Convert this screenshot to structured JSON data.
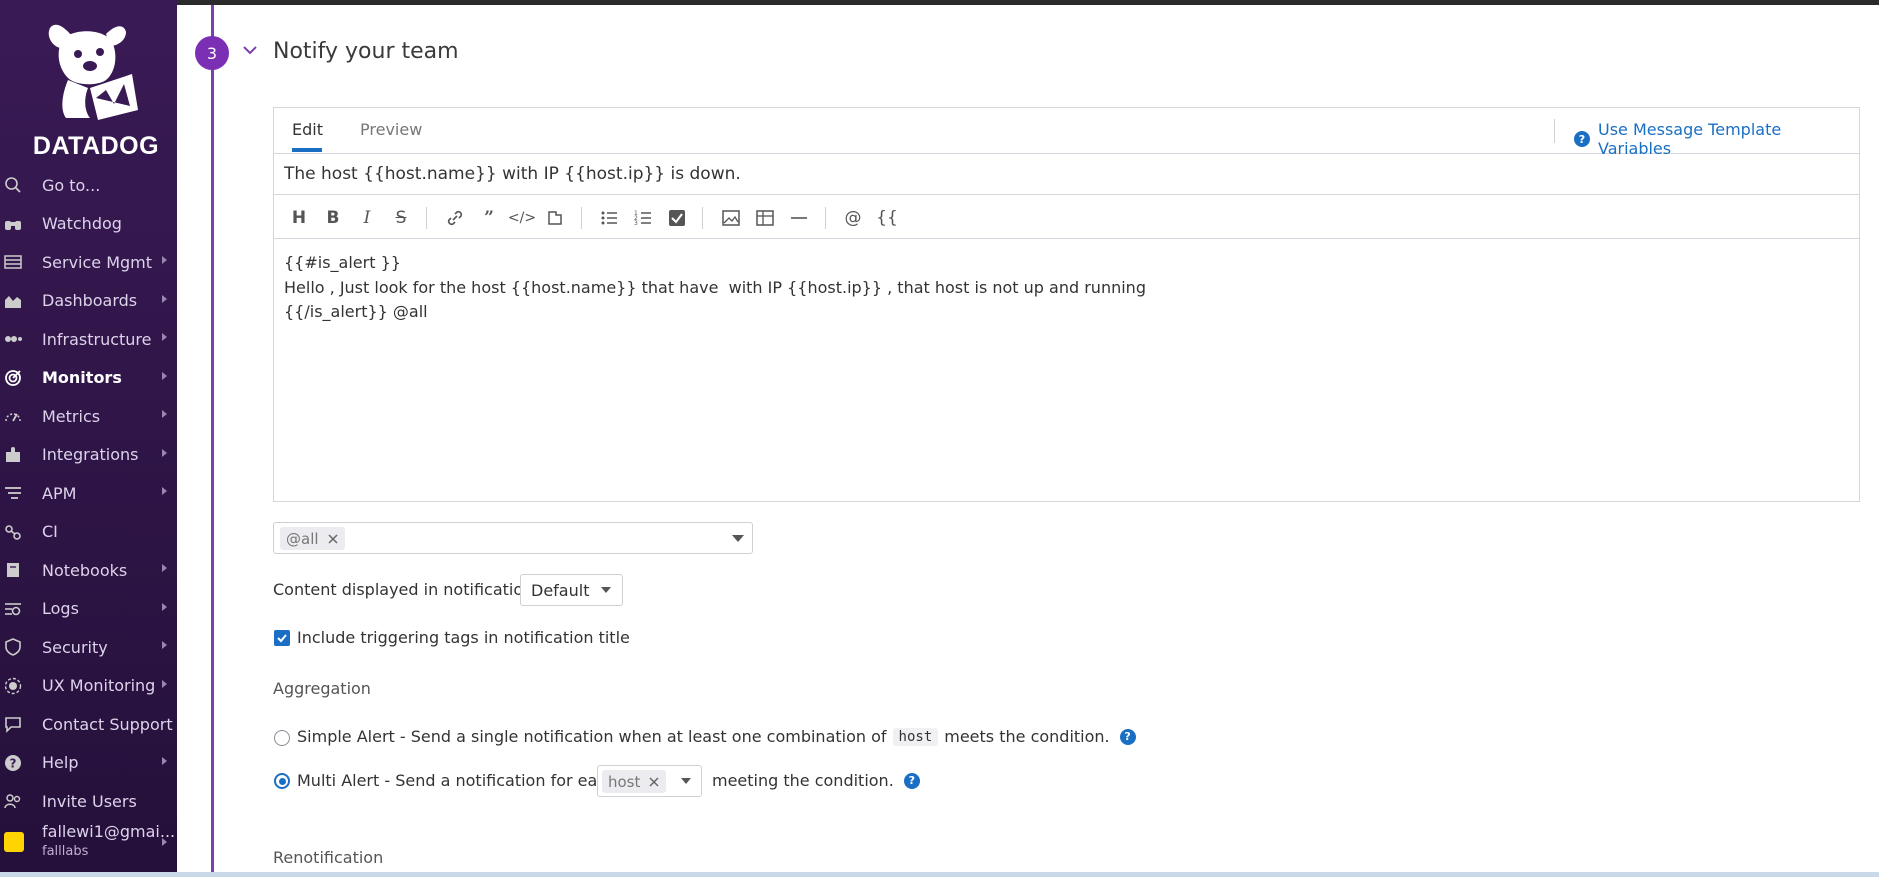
{
  "sidebar": {
    "logo_text": "DATADOG",
    "items": [
      {
        "label": "Go to...",
        "icon": "search-icon",
        "arrow": false
      },
      {
        "label": "Watchdog",
        "icon": "binoculars-icon",
        "arrow": false
      },
      {
        "label": "Service Mgmt",
        "icon": "service-icon",
        "arrow": true
      },
      {
        "label": "Dashboards",
        "icon": "dashboard-icon",
        "arrow": true
      },
      {
        "label": "Infrastructure",
        "icon": "infrastructure-icon",
        "arrow": true
      },
      {
        "label": "Monitors",
        "icon": "monitor-icon",
        "arrow": true,
        "active": true
      },
      {
        "label": "Metrics",
        "icon": "metrics-icon",
        "arrow": true
      },
      {
        "label": "Integrations",
        "icon": "puzzle-icon",
        "arrow": true
      },
      {
        "label": "APM",
        "icon": "apm-icon",
        "arrow": true
      },
      {
        "label": "CI",
        "icon": "ci-icon",
        "arrow": false
      },
      {
        "label": "Notebooks",
        "icon": "notebook-icon",
        "arrow": true
      },
      {
        "label": "Logs",
        "icon": "logs-icon",
        "arrow": true
      },
      {
        "label": "Security",
        "icon": "shield-icon",
        "arrow": true
      },
      {
        "label": "UX Monitoring",
        "icon": "ux-icon",
        "arrow": true
      },
      {
        "label": "Contact Support",
        "icon": "chat-icon",
        "arrow": false
      },
      {
        "label": "Help",
        "icon": "help-icon",
        "arrow": true
      },
      {
        "label": "Invite Users",
        "icon": "users-icon",
        "arrow": false
      }
    ],
    "user": {
      "email": "fallewi1@gmai...",
      "org": "falllabs"
    }
  },
  "section": {
    "step": "3",
    "title": "Notify your team"
  },
  "editor": {
    "tabs": [
      "Edit",
      "Preview"
    ],
    "template_link": "Use Message Template Variables",
    "title_value": "The host {{host.name}} with IP {{host.ip}} is down.",
    "toolbar": {
      "mention": "@",
      "template": "{{"
    },
    "body_lines": [
      "{{#is_alert }}",
      "Hello , Just look for the host {{host.name}} that have  with IP {{host.ip}} , that host is not up and running",
      "{{/is_alert}} @all"
    ]
  },
  "recipients": {
    "chip": "@all"
  },
  "content_display": {
    "label": "Content displayed in notification",
    "value": "Default"
  },
  "include_tags": {
    "label": "Include triggering tags in notification title",
    "checked": true
  },
  "aggregation": {
    "heading": "Aggregation",
    "simple": {
      "prefix": "Simple Alert - Send a single notification when at least one combination of",
      "code": "host",
      "suffix": "meets the condition."
    },
    "multi": {
      "prefix": "Multi Alert - Send a notification for each",
      "chip": "host",
      "suffix": "meeting the condition.",
      "selected": true
    }
  },
  "renotification": {
    "heading": "Renotification"
  }
}
